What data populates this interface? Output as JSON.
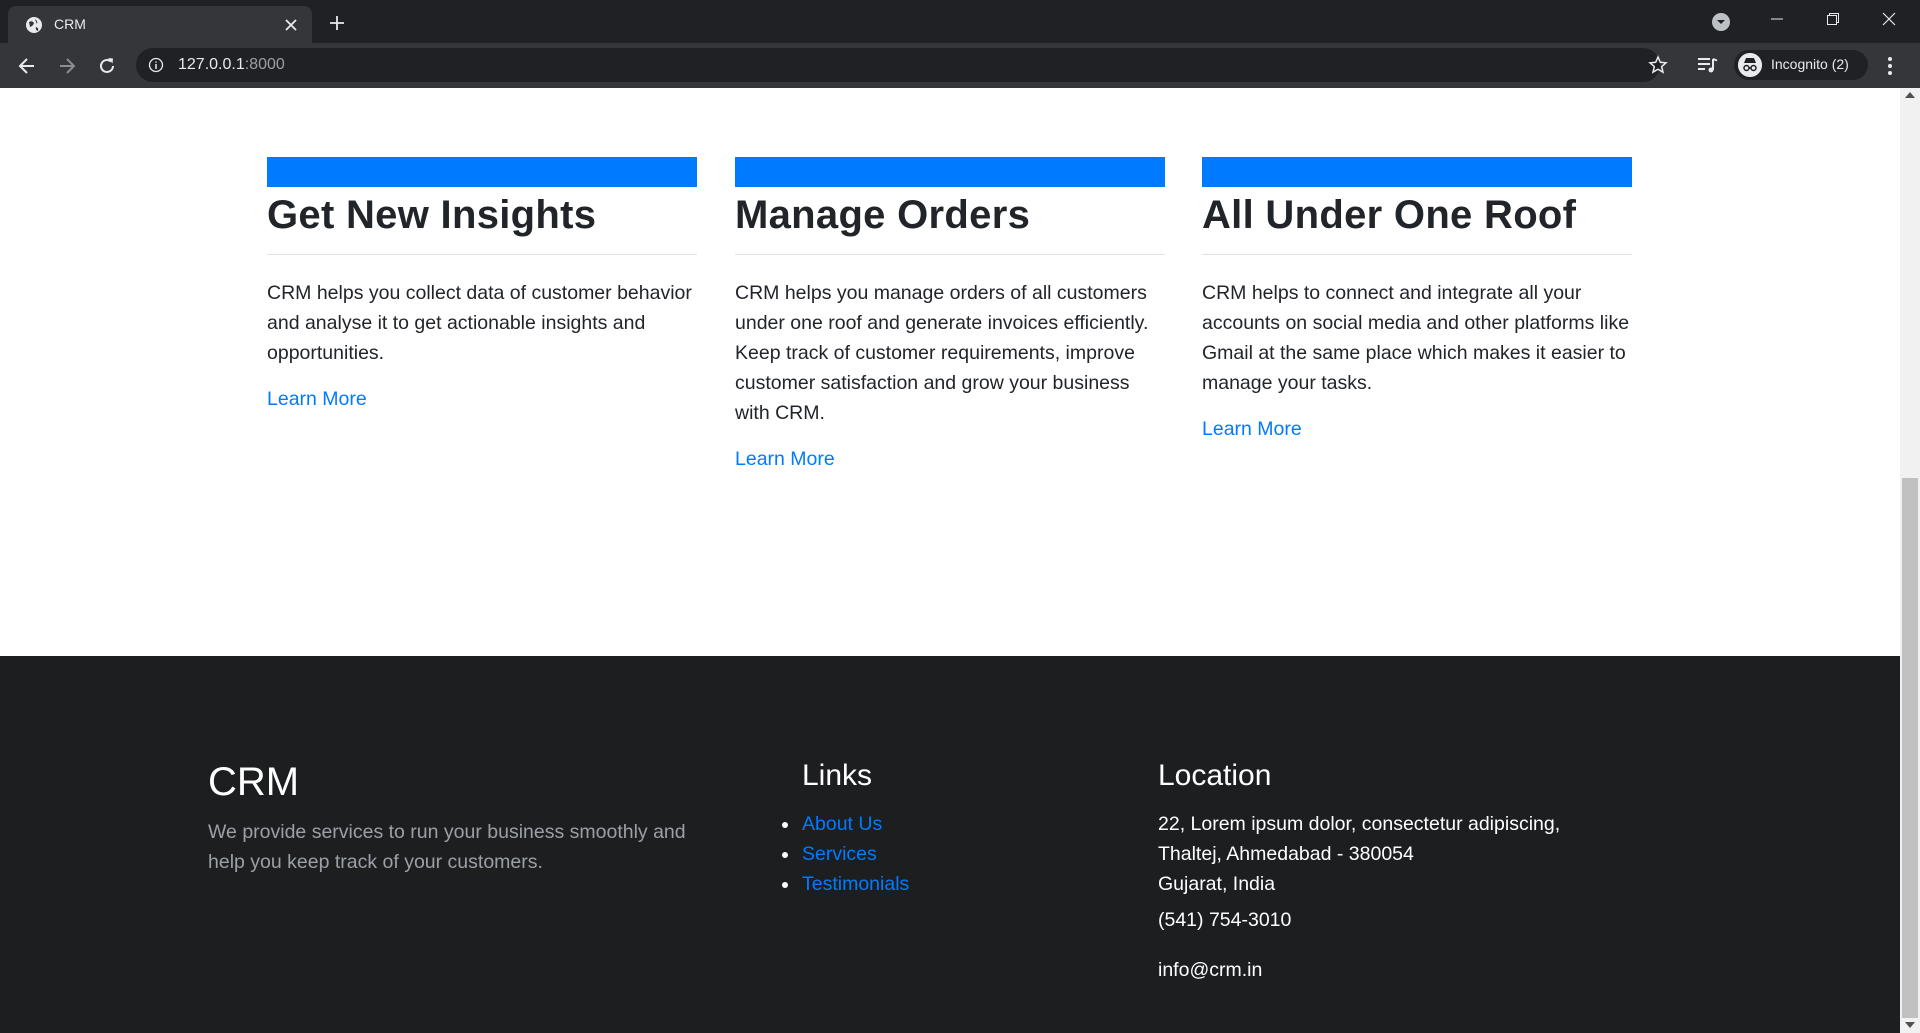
{
  "browser": {
    "tab_title": "CRM",
    "url_host": "127.0.0.1",
    "url_port": ":8000",
    "profile_label": "Incognito (2)",
    "icons": [
      "globe-icon",
      "close-icon",
      "plus-icon",
      "back-icon",
      "forward-icon",
      "reload-icon",
      "info-icon",
      "star-icon",
      "reading-list-icon",
      "incognito-icon",
      "more-icon"
    ]
  },
  "features": [
    {
      "title": "Get New Insights",
      "text": "CRM helps you collect data of customer behavior and analyse it to get actionable insights and opportunities.",
      "link": "Learn More"
    },
    {
      "title": "Manage Orders",
      "text": "CRM helps you manage orders of all customers under one roof and generate invoices efficiently. Keep track of customer requirements, improve customer satisfaction and grow your business with CRM.",
      "link": "Learn More"
    },
    {
      "title": "All Under One Roof",
      "text": "CRM helps to connect and integrate all your accounts on social media and other platforms like Gmail at the same place which makes it easier to manage your tasks.",
      "link": "Learn More"
    }
  ],
  "footer": {
    "brand": "CRM",
    "description": "We provide services to run your business smoothly and help you keep track of your customers.",
    "links_title": "Links",
    "links": [
      "About Us",
      "Services",
      "Testimonials"
    ],
    "location_title": "Location",
    "address_line1": "22, Lorem ipsum dolor, consectetur adipiscing,",
    "address_line2": "Thaltej, Ahmedabad - 380054",
    "address_line3": "Gujarat, India",
    "phone": "(541) 754-3010",
    "email": "info@crm.in"
  },
  "colors": {
    "accent": "#007bff",
    "footer_bg": "#1d1e20",
    "chrome_dark": "#202124",
    "chrome_toolbar": "#35363a"
  }
}
